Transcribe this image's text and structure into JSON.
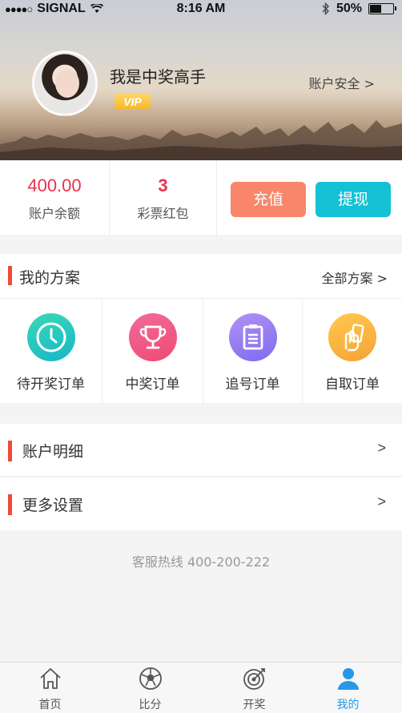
{
  "status_bar": {
    "signal_dots": "●●●●○",
    "carrier": "SIGNAL",
    "time": "8:16 AM",
    "battery": "50%",
    "battery_level": 0.5
  },
  "profile": {
    "username": "我是中奖高手",
    "vip_badge": "VIP",
    "security_link": "账户安全 >"
  },
  "balance": {
    "amount": "400.00",
    "amount_label": "账户余额",
    "redpacket_count": "3",
    "redpacket_label": "彩票红包",
    "recharge_label": "充值",
    "withdraw_label": "提现"
  },
  "plans": {
    "title": "我的方案",
    "all_link": "全部方案 >",
    "items": [
      {
        "label": "待开奖订单",
        "icon": "clock-icon"
      },
      {
        "label": "中奖订单",
        "icon": "trophy-icon"
      },
      {
        "label": "追号订单",
        "icon": "clipboard-icon"
      },
      {
        "label": "自取订单",
        "icon": "hand-ticket-icon"
      }
    ]
  },
  "rows": {
    "account_detail": "账户明细",
    "more_settings": "更多设置",
    "chevron": ">"
  },
  "hotline": "客服热线 400-200-222",
  "tabbar": {
    "items": [
      {
        "label": "首页",
        "icon": "home-icon"
      },
      {
        "label": "比分",
        "icon": "football-icon"
      },
      {
        "label": "开奖",
        "icon": "target-icon"
      },
      {
        "label": "我的",
        "icon": "person-icon"
      }
    ]
  },
  "colors": {
    "accent_red": "#e8344a",
    "section_bar": "#f04b3a",
    "recharge_btn": "#f9866a",
    "withdraw_btn": "#14c1d5",
    "active_tab": "#2997e8"
  }
}
